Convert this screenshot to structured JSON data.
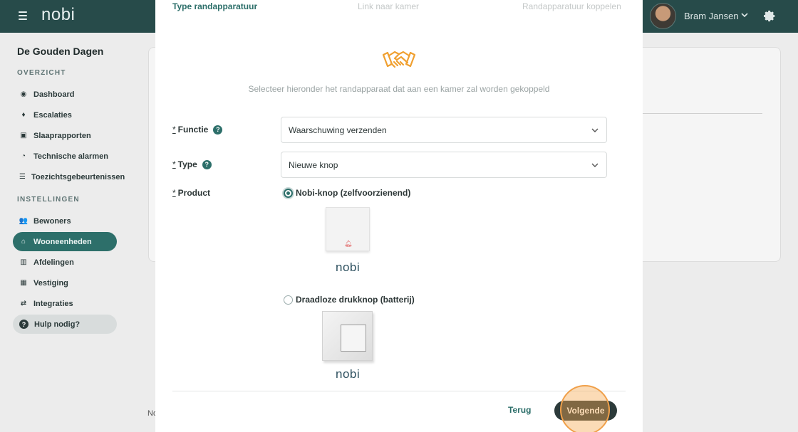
{
  "topbar": {
    "brand": "nobi",
    "user_name": "Bram Jansen"
  },
  "sidebar": {
    "org_name": "De Gouden Dagen",
    "section_overview": "OVERZICHT",
    "section_settings": "INSTELLINGEN",
    "overview_items": [
      {
        "label": "Dashboard",
        "icon": "dashboard-icon"
      },
      {
        "label": "Escalaties",
        "icon": "escalation-icon"
      },
      {
        "label": "Slaaprapporten",
        "icon": "sleep-report-icon"
      },
      {
        "label": "Technische alarmen",
        "icon": "alarm-clock-icon"
      },
      {
        "label": "Toezichtsgebeurtenissen",
        "icon": "supervision-icon"
      }
    ],
    "settings_items": [
      {
        "label": "Bewoners",
        "icon": "residents-icon"
      },
      {
        "label": "Wooneenheden",
        "icon": "home-icon"
      },
      {
        "label": "Afdelingen",
        "icon": "department-icon"
      },
      {
        "label": "Vestiging",
        "icon": "building-icon"
      },
      {
        "label": "Integraties",
        "icon": "integration-icon"
      }
    ],
    "help_label": "Hulp nodig?"
  },
  "background": {
    "snippet": "No"
  },
  "modal": {
    "steps": [
      {
        "label": "Type randapparatuur",
        "state": "active"
      },
      {
        "label": "Link naar kamer",
        "state": "inactive"
      },
      {
        "label": "Randapparatuur koppelen",
        "state": "inactive"
      }
    ],
    "subtitle": "Selecteer hieronder het randapparaat dat aan een kamer zal worden gekoppeld",
    "fields": {
      "function": {
        "required": "*",
        "label": "Functie",
        "value": "Waarschuwing verzenden"
      },
      "type": {
        "required": "*",
        "label": "Type",
        "value": "Nieuwe knop"
      },
      "product": {
        "required": "*",
        "label": "Product"
      }
    },
    "products": [
      {
        "label": "Nobi-knop (zelfvoorzienend)",
        "selected": true,
        "brand": "nobi"
      },
      {
        "label": "Draadloze drukknop (batterij)",
        "selected": false,
        "brand": "nobi"
      }
    ],
    "buttons": {
      "back": "Terug",
      "next": "Volgende"
    }
  },
  "colors": {
    "topbar": "#274b4a",
    "accent": "#2d6f6a",
    "icon_orange": "#f0a030",
    "next_button": "#2c3a3a"
  }
}
